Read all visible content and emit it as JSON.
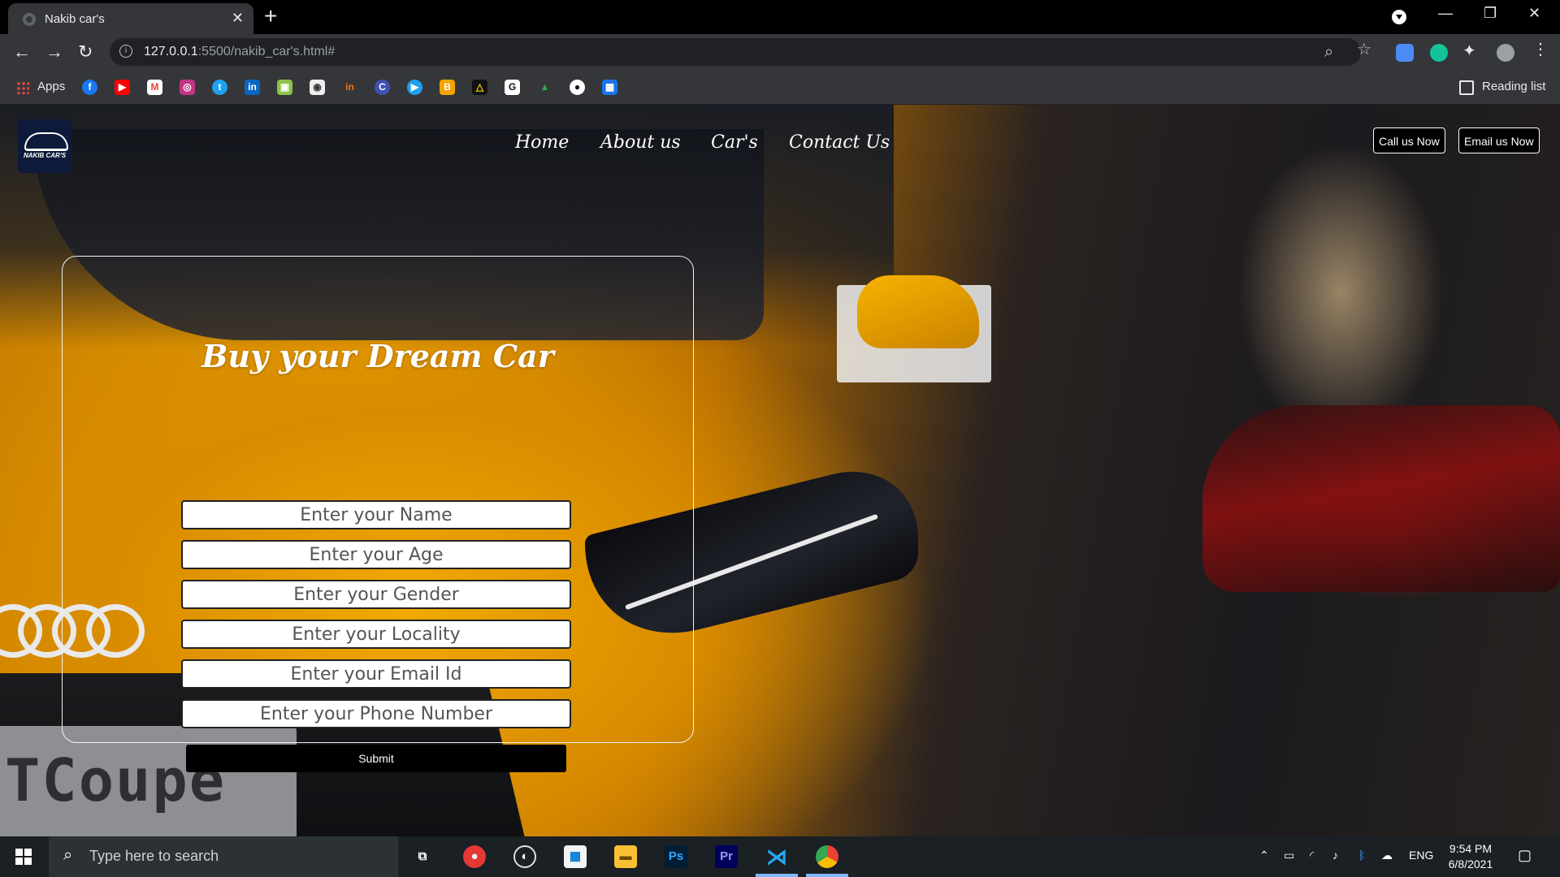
{
  "browser": {
    "tab_title": "Nakib car's",
    "url_host": "127.0.0.1",
    "url_path": ":5500/nakib_car's.html#",
    "bookmarks_apps_label": "Apps",
    "reading_list_label": "Reading list"
  },
  "site": {
    "logo_text": "NAKIB CAR'S",
    "nav": [
      "Home",
      "About us",
      "Car's",
      "Contact Us"
    ],
    "call_label": "Call us Now",
    "email_label": "Email us Now",
    "plate_text": "TCoupe"
  },
  "form": {
    "title": "Buy your Dream Car",
    "fields": [
      {
        "placeholder": "Enter your Name"
      },
      {
        "placeholder": "Enter your Age"
      },
      {
        "placeholder": "Enter your Gender"
      },
      {
        "placeholder": "Enter your Locality"
      },
      {
        "placeholder": "Enter your Email Id"
      },
      {
        "placeholder": "Enter your Phone Number"
      }
    ],
    "submit_label": "Submit"
  },
  "taskbar": {
    "search_placeholder": "Type here to search",
    "language": "ENG",
    "time": "9:54 PM",
    "date": "6/8/2021"
  }
}
